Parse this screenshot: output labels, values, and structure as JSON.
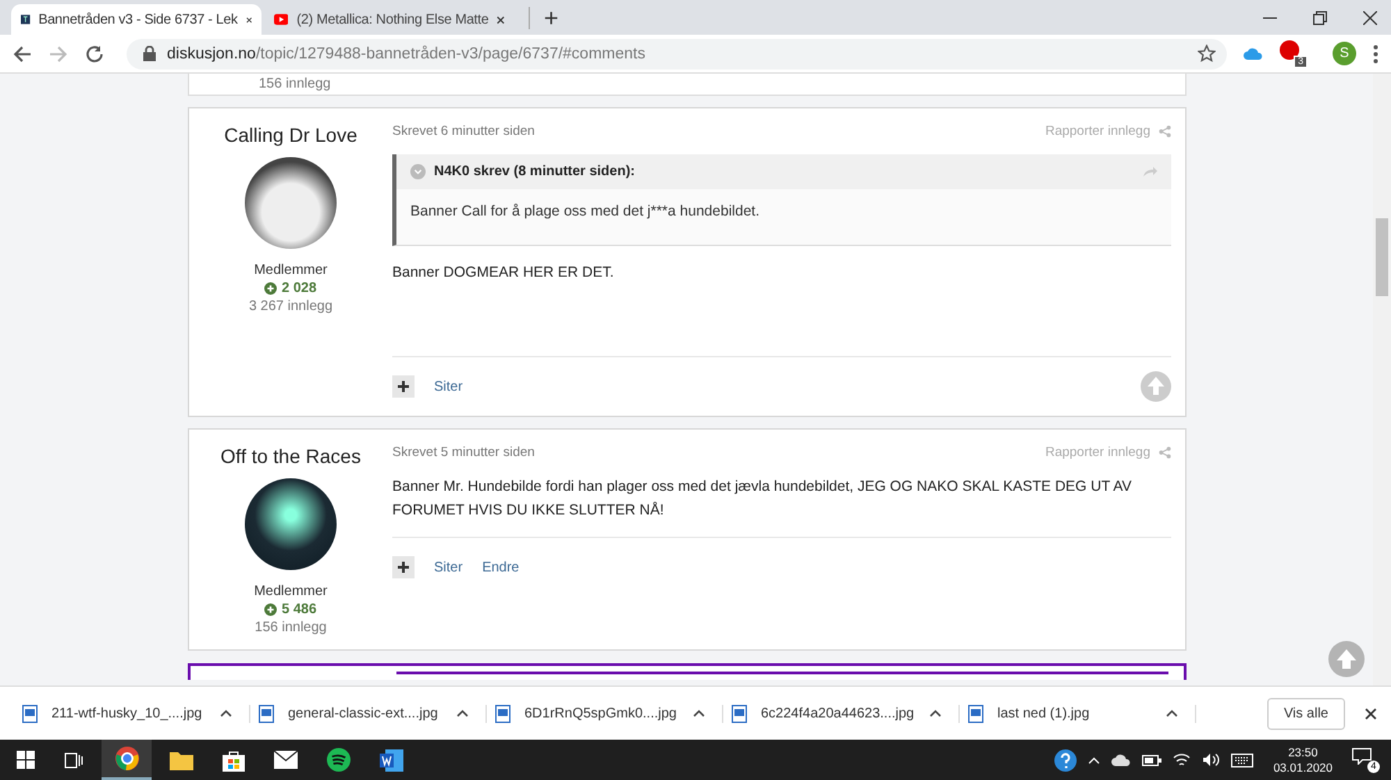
{
  "tabs": [
    {
      "title": "Bannetråden v3 - Side 6737 - Lek",
      "kind": "forum",
      "selected": true
    },
    {
      "title": "(2) Metallica: Nothing Else Matte",
      "kind": "video",
      "selected": false
    }
  ],
  "new_tab": "+",
  "address": {
    "host": "diskusjon.no",
    "path": "/topic/1279488-bannetråden-v3/page/6737/#comments"
  },
  "profile": {
    "initial": "S"
  },
  "extension_badge": "3",
  "previous_post": {
    "count": "156 innlegg"
  },
  "posts": [
    {
      "author": "Calling Dr Love",
      "avatar": {
        "kind": "dog"
      },
      "group": "Medlemmer",
      "reputation": "2 028",
      "post_count": "3 267 innlegg",
      "date": "Skrevet 6 minutter siden",
      "report": "Rapporter innlegg",
      "quote": {
        "header": "N4K0 skrev (8 minutter siden):",
        "text": "Banner Call for å plage oss med det j***a hundebildet."
      },
      "body": "Banner DOGMEAR HER ER DET.",
      "actions": [
        "Siter"
      ],
      "upvote": true
    },
    {
      "author": "Off to the Races",
      "avatar": {
        "kind": "album"
      },
      "group": "Medlemmer",
      "reputation": "5 486",
      "post_count": "156 innlegg",
      "date": "Skrevet 5 minutter siden",
      "report": "Rapporter innlegg",
      "body": "Banner Mr. Hundebilde fordi han plager oss med det jævla hundebildet, JEG OG NAKO SKAL KASTE DEG UT AV FORUMET HVIS DU IKKE SLUTTER NÅ!",
      "actions": [
        "Siter",
        "Endre"
      ],
      "upvote": false
    }
  ],
  "downloads": [
    "211-wtf-husky_10_....jpg",
    "general-classic-ext....jpg",
    "6D1rRnQ5spGmk0....jpg",
    "6c224f4a20a44623....jpg",
    "last ned (1).jpg"
  ],
  "show_all": "Vis alle",
  "clock": {
    "time": "23:50",
    "date": "03.01.2020"
  },
  "notifications": "4"
}
